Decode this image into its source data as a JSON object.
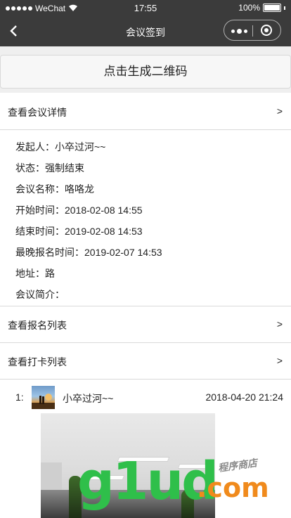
{
  "status_bar": {
    "carrier": "WeChat",
    "time": "17:55",
    "battery": "100%"
  },
  "nav": {
    "title": "会议签到"
  },
  "qr_button": {
    "label": "点击生成二维码"
  },
  "sections": {
    "meeting_details": "查看会议详情",
    "signup_list": "查看报名列表",
    "checkin_list": "查看打卡列表",
    "chevron": ">"
  },
  "details": [
    {
      "key": "发起人",
      "value": "小卒过河~~"
    },
    {
      "key": "状态",
      "value": "强制结束"
    },
    {
      "key": "会议名称",
      "value": "咯咯龙"
    },
    {
      "key": "开始时间",
      "value": "2018-02-08 14:55"
    },
    {
      "key": "结束时间",
      "value": "2019-02-08 14:53"
    },
    {
      "key": "最晚报名时间",
      "value": "2019-02-07 14:53"
    },
    {
      "key": "地址",
      "value": "路"
    },
    {
      "key": "会议简介",
      "value": ""
    }
  ],
  "checkins": [
    {
      "index": "1:",
      "name": "小卒过河~~",
      "timestamp": "2018-04-20 21:24"
    }
  ],
  "watermark": {
    "brand": "g1ud",
    "suffix": ".com",
    "tagline": "程序商店"
  },
  "colors": {
    "header_bg": "#3b3b3b",
    "band_bg": "#efefef",
    "watermark_green": "#2fbf4a",
    "watermark_orange": "#f08a1c"
  }
}
